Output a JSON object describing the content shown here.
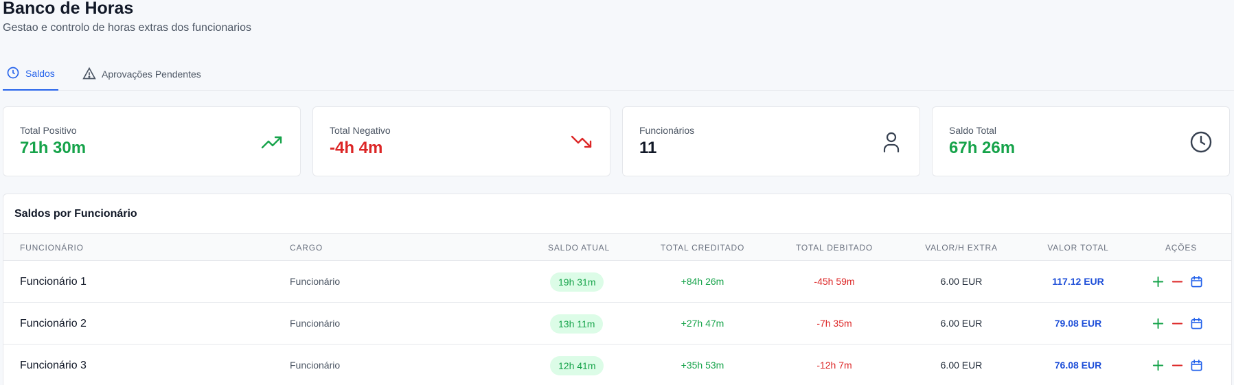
{
  "header": {
    "title": "Banco de Horas",
    "subtitle": "Gestao e controlo de horas extras dos funcionarios"
  },
  "tabs": [
    {
      "label": "Saldos",
      "icon": "clock-icon",
      "active": true
    },
    {
      "label": "Aprovações Pendentes",
      "icon": "alert-triangle-icon",
      "active": false
    }
  ],
  "stats": [
    {
      "label": "Total Positivo",
      "value": "71h 30m",
      "icon": "trending-up-icon",
      "color": "#16a34a"
    },
    {
      "label": "Total Negativo",
      "value": "-4h 4m",
      "icon": "trending-down-icon",
      "color": "#dc2626"
    },
    {
      "label": "Funcionários",
      "value": "11",
      "icon": "user-icon",
      "color": "#111827"
    },
    {
      "label": "Saldo Total",
      "value": "67h 26m",
      "icon": "clock-icon",
      "color": "#16a34a"
    }
  ],
  "table": {
    "title": "Saldos por Funcionário",
    "columns": [
      "FUNCIONÁRIO",
      "CARGO",
      "SALDO ATUAL",
      "TOTAL CREDITADO",
      "TOTAL DEBITADO",
      "VALOR/H EXTRA",
      "VALOR TOTAL",
      "AÇÕES"
    ],
    "rows": [
      {
        "name": "Funcionário 1",
        "role": "Funcionário",
        "saldo": "19h 31m",
        "credited": "+84h 26m",
        "debited": "-45h 59m",
        "rate": "6.00 EUR",
        "total": "117.12 EUR"
      },
      {
        "name": "Funcionário 2",
        "role": "Funcionário",
        "saldo": "13h 11m",
        "credited": "+27h 47m",
        "debited": "-7h 35m",
        "rate": "6.00 EUR",
        "total": "79.08 EUR"
      },
      {
        "name": "Funcionário 3",
        "role": "Funcionário",
        "saldo": "12h 41m",
        "credited": "+35h 53m",
        "debited": "-12h 7m",
        "rate": "6.00 EUR",
        "total": "76.08 EUR"
      }
    ],
    "actions": [
      "plus-icon",
      "minus-icon",
      "calendar-icon"
    ]
  },
  "colors": {
    "accent": "#2563eb",
    "positive": "#16a34a",
    "negative": "#dc2626",
    "total": "#1d4ed8"
  }
}
